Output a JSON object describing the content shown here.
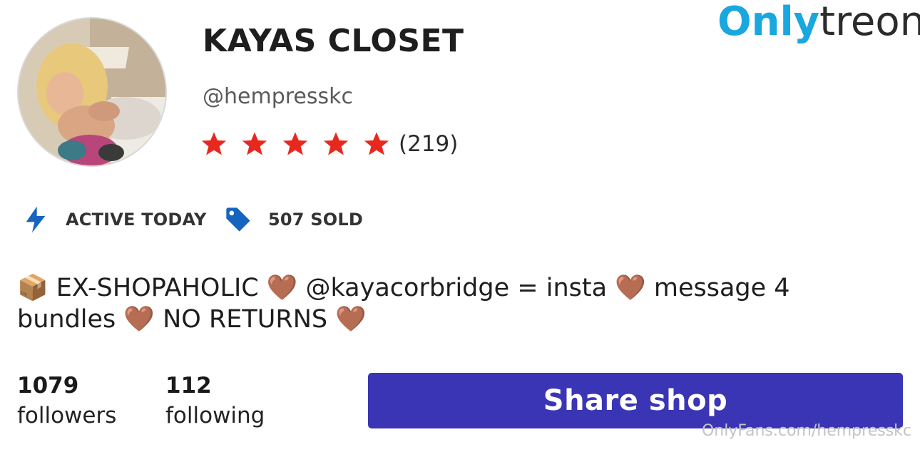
{
  "profile": {
    "shop_name": "KAYAS CLOSET",
    "handle": "@hempresskc",
    "rating_stars": 5,
    "rating_count": "(219)",
    "star_color": "#e8281f"
  },
  "brand": {
    "logo_part1": "Only",
    "logo_part2": "treon",
    "logo_color": "#19a7e0"
  },
  "meta": {
    "active_label": "ACTIVE TODAY",
    "active_icon": "lightning-bolt-icon",
    "sold_label": "507 SOLD",
    "sold_icon": "price-tag-icon",
    "icon_color": "#1565c0"
  },
  "bio": {
    "text": "📦 EX-SHOPAHOLIC 🤎 @kayacorbridge = insta 🤎 message 4 bundles 🤎 NO RETURNS 🤎"
  },
  "stats": {
    "followers_count": "1079",
    "followers_label": "followers",
    "following_count": "112",
    "following_label": "following"
  },
  "actions": {
    "share_label": "Share shop",
    "share_color": "#3a35b5"
  },
  "watermark": {
    "text": "OnlyFans.com/hempresskc"
  }
}
